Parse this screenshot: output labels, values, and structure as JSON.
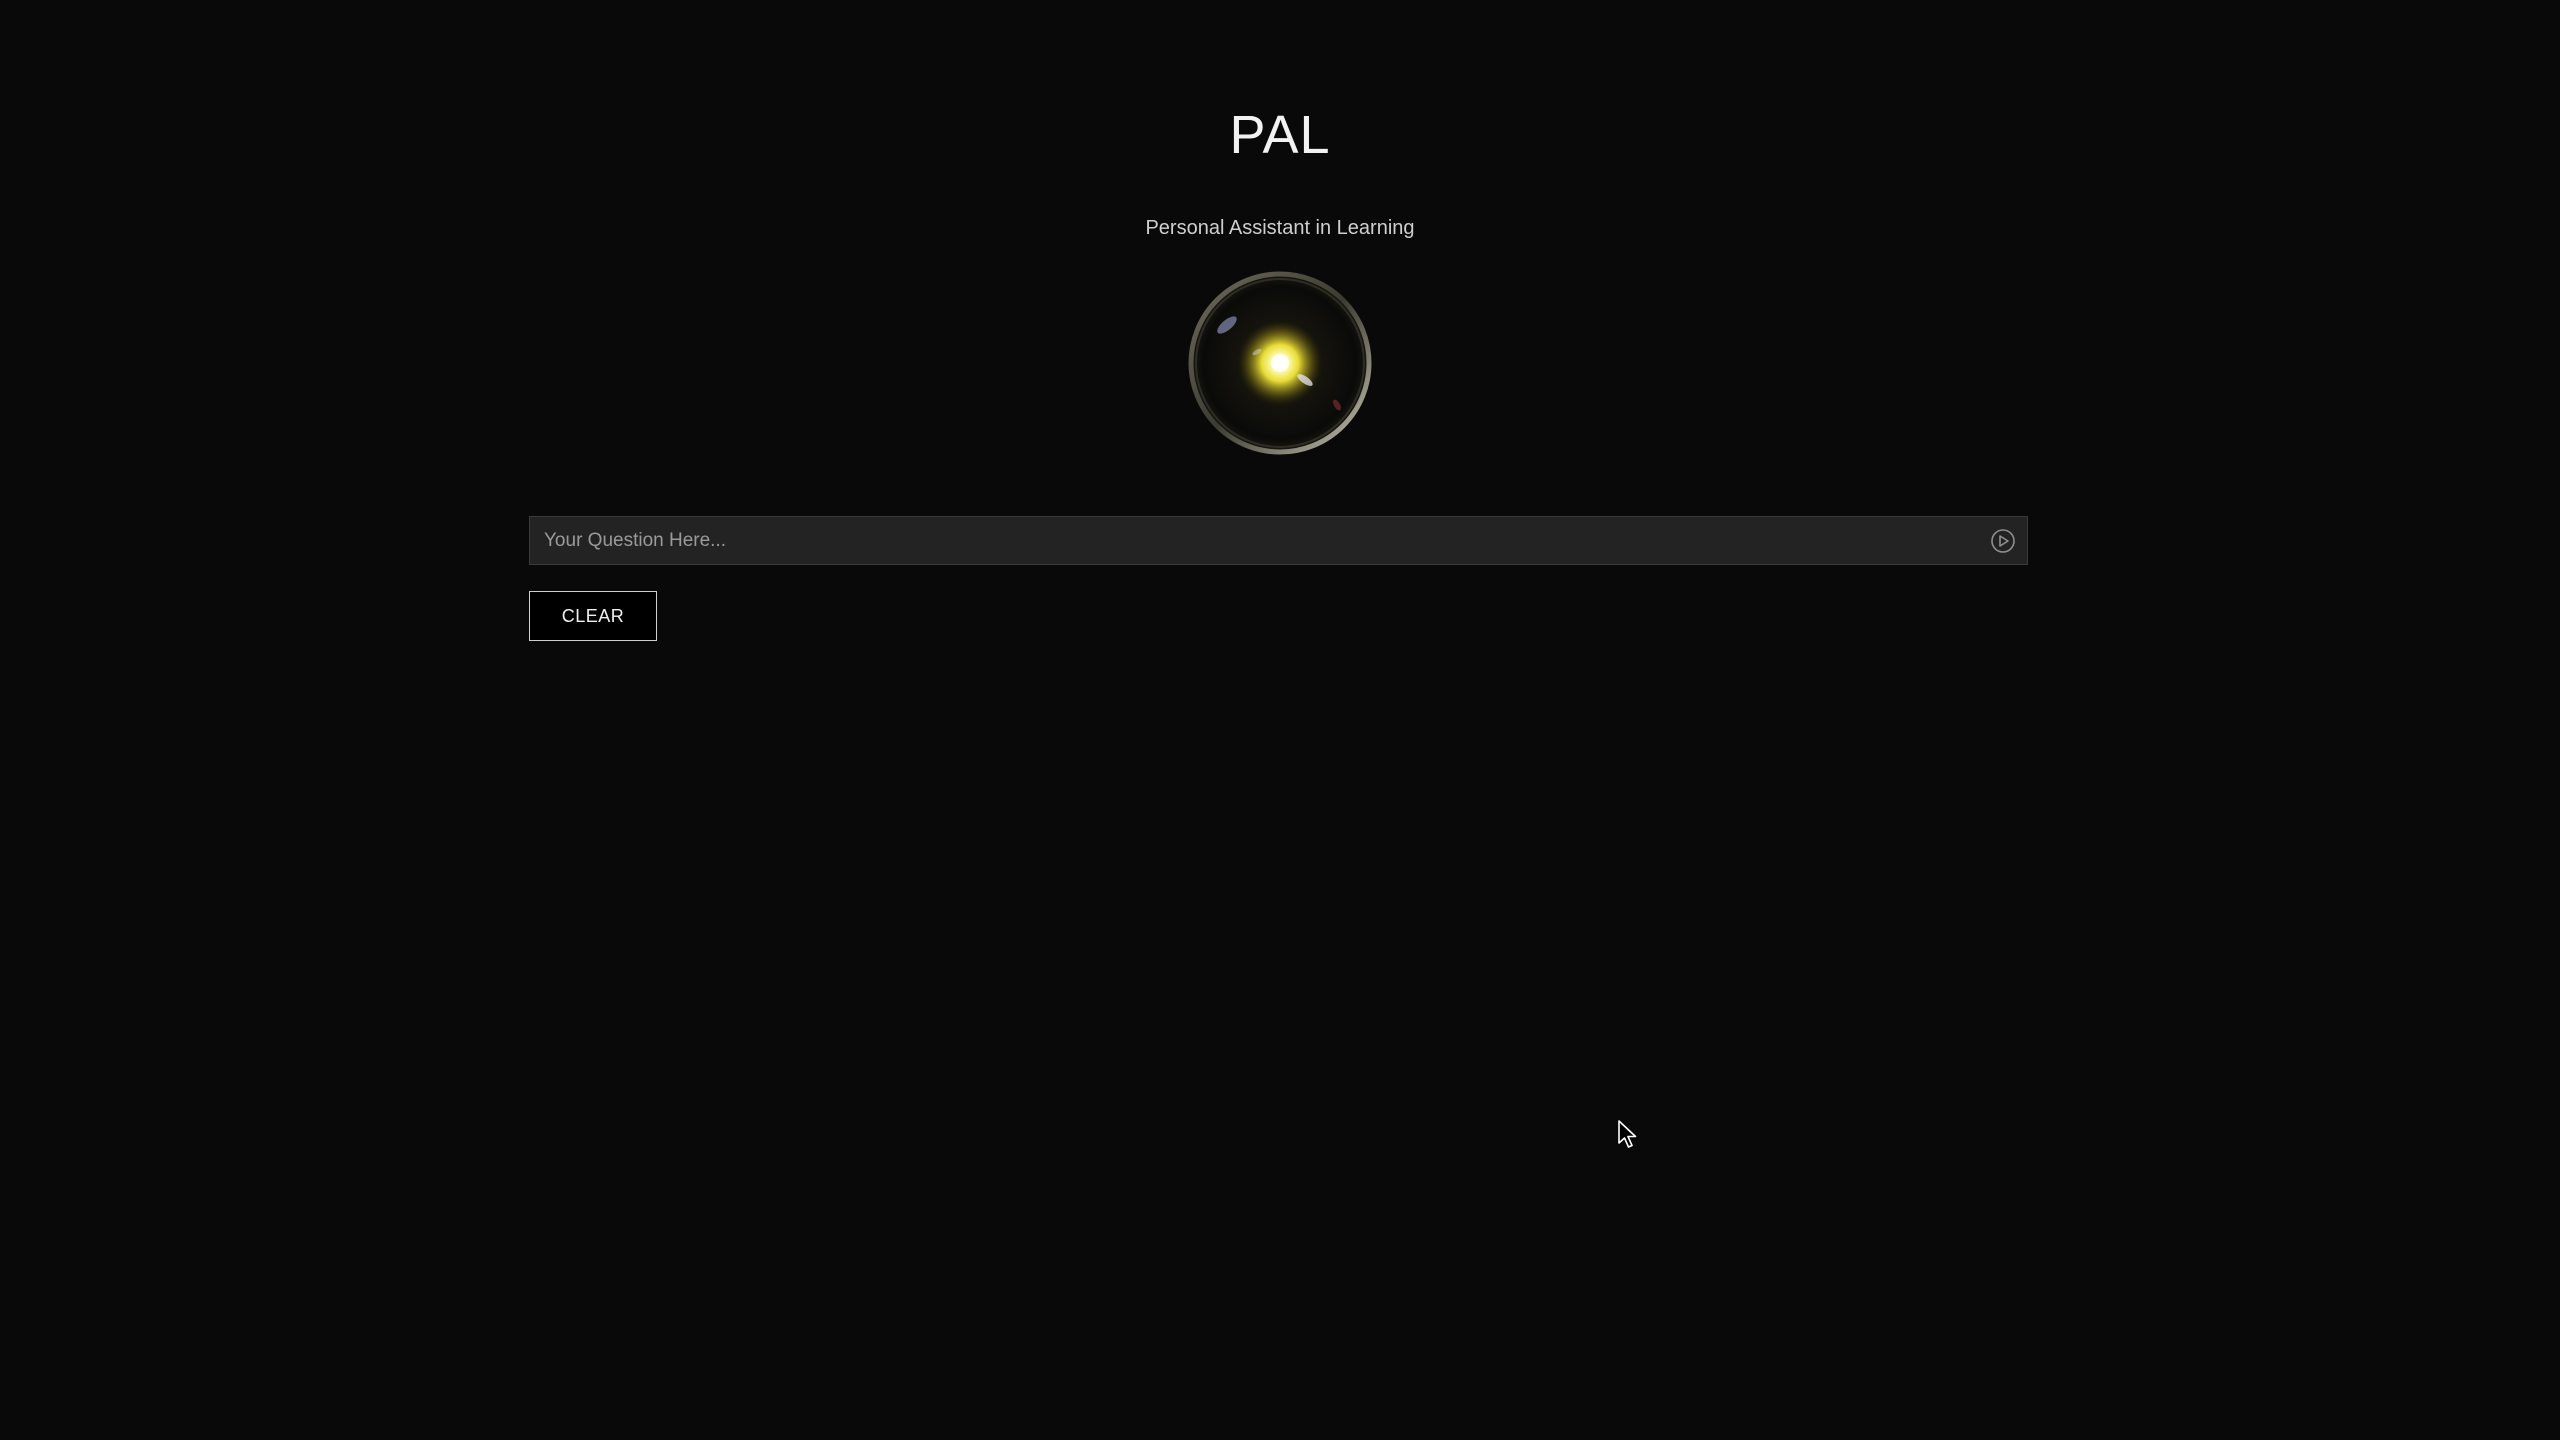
{
  "app": {
    "title": "PAL",
    "subtitle": "Personal Assistant in Learning"
  },
  "orb": {
    "icon": "glowing-orb-icon",
    "core_color": "#f5ef7a",
    "ring_color": "#9a9a86"
  },
  "question": {
    "placeholder": "Your Question Here...",
    "value": "",
    "submit_icon": "play-circle-icon"
  },
  "actions": {
    "clear_label": "CLEAR"
  },
  "colors": {
    "background": "#090909",
    "input_background": "#232323",
    "text": "#f2f2f2"
  }
}
